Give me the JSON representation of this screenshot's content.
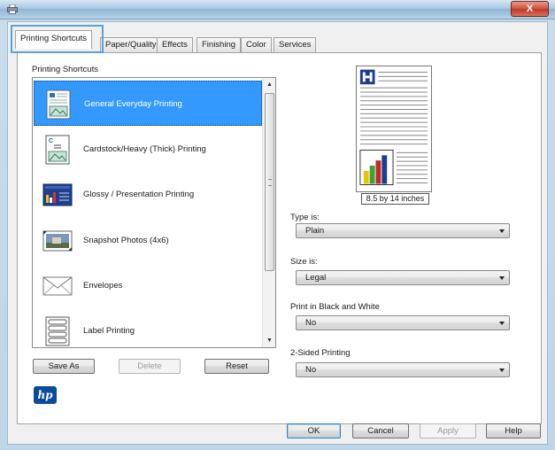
{
  "window": {
    "close_label": "X",
    "app_icon": "printer-icon"
  },
  "tabs": [
    {
      "label": "Printing Shortcuts",
      "active": true
    },
    {
      "label": "Paper/Quality",
      "active": false
    },
    {
      "label": "Effects",
      "active": false
    },
    {
      "label": "Finishing",
      "active": false
    },
    {
      "label": "Color",
      "active": false
    },
    {
      "label": "Services",
      "active": false
    }
  ],
  "shortcuts": {
    "heading": "Printing Shortcuts",
    "items": [
      {
        "label": "General Everyday Printing",
        "icon": "document-icon",
        "selected": true
      },
      {
        "label": "Cardstock/Heavy (Thick) Printing",
        "icon": "cardstock-icon",
        "selected": false
      },
      {
        "label": "Glossy / Presentation Printing",
        "icon": "presentation-icon",
        "selected": false
      },
      {
        "label": "Snapshot Photos (4x6)",
        "icon": "photo-icon",
        "selected": false
      },
      {
        "label": "Envelopes",
        "icon": "envelope-icon",
        "selected": false
      },
      {
        "label": "Label Printing",
        "icon": "labels-icon",
        "selected": false
      }
    ],
    "buttons": {
      "save_as": "Save As",
      "delete": "Delete",
      "reset": "Reset"
    }
  },
  "preview": {
    "size_label": "8.5 by 14 inches"
  },
  "settings": {
    "type_label": "Type is:",
    "type_value": "Plain",
    "size_label": "Size is:",
    "size_value": "Legal",
    "bw_label": "Print in Black and White",
    "bw_value": "No",
    "duplex_label": "2-Sided Printing",
    "duplex_value": "No"
  },
  "footer": {
    "ok": "OK",
    "cancel": "Cancel",
    "apply": "Apply",
    "help": "Help",
    "logo_text": "hp"
  },
  "colors": {
    "selection": "#3399ff",
    "tab_focus": "#5aa3d8"
  }
}
